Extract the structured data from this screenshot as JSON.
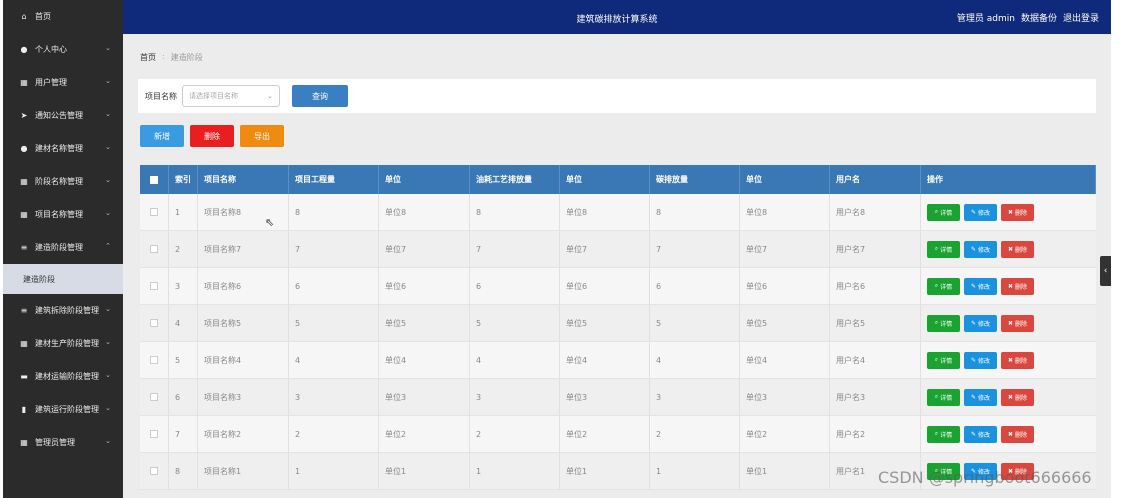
{
  "sidebar": {
    "items": [
      {
        "label": "首页",
        "icon": "home-icon",
        "glyph": "⌂",
        "chev": ""
      },
      {
        "label": "个人中心",
        "icon": "user-icon",
        "glyph": "●",
        "chev": "⌄"
      },
      {
        "label": "用户管理",
        "icon": "grid-icon",
        "glyph": "▦",
        "chev": "⌄"
      },
      {
        "label": "通知公告管理",
        "icon": "send-icon",
        "glyph": "➤",
        "chev": "⌄"
      },
      {
        "label": "建材名称管理",
        "icon": "pin-icon",
        "glyph": "●",
        "chev": "⌄"
      },
      {
        "label": "阶段名称管理",
        "icon": "grid-icon",
        "glyph": "▦",
        "chev": "⌄"
      },
      {
        "label": "项目名称管理",
        "icon": "grid-icon",
        "glyph": "▦",
        "chev": "⌄"
      },
      {
        "label": "建造阶段管理",
        "icon": "list-icon",
        "glyph": "≡",
        "chev": "⌃"
      }
    ],
    "sub_item": "建造阶段",
    "items_after": [
      {
        "label": "建筑拆除阶段管理",
        "icon": "list-icon",
        "glyph": "≡",
        "chev": "⌄"
      },
      {
        "label": "建材生产阶段管理",
        "icon": "grid-icon",
        "glyph": "▦",
        "chev": "⌄"
      },
      {
        "label": "建材运输阶段管理",
        "icon": "monitor-icon",
        "glyph": "▬",
        "chev": "⌄"
      },
      {
        "label": "建筑运行阶段管理",
        "icon": "chart-icon",
        "glyph": "▮",
        "chev": "⌄"
      },
      {
        "label": "管理员管理",
        "icon": "grid-icon",
        "glyph": "▦",
        "chev": "⌄"
      }
    ]
  },
  "topbar": {
    "title": "建筑碳排放计算系统",
    "role": "管理员 admin",
    "backup": "数据备份",
    "logout": "退出登录"
  },
  "breadcrumb": {
    "home": "首页",
    "sep": ":",
    "current": "建造阶段"
  },
  "search": {
    "label": "项目名称",
    "placeholder": "请选择项目名称",
    "button": "查询"
  },
  "actions": {
    "add": "新增",
    "delete": "删除",
    "export": "导出"
  },
  "colors": {
    "add": "#3a9be3",
    "delete": "#e91e1e",
    "export": "#f08b12",
    "header": "#3a77b5",
    "topbar": "#0f2a7a"
  },
  "table": {
    "headers": [
      "索引",
      "项目名称",
      "项目工程量",
      "单位",
      "油耗工艺排放量",
      "单位",
      "碳排放量",
      "单位",
      "用户名",
      "操作"
    ],
    "ops": {
      "detail": "详情",
      "edit": "修改",
      "delete": "删除"
    },
    "rows": [
      [
        "1",
        "项目名称8",
        "8",
        "单位8",
        "8",
        "单位8",
        "8",
        "单位8",
        "用户名8"
      ],
      [
        "2",
        "项目名称7",
        "7",
        "单位7",
        "7",
        "单位7",
        "7",
        "单位7",
        "用户名7"
      ],
      [
        "3",
        "项目名称6",
        "6",
        "单位6",
        "6",
        "单位6",
        "6",
        "单位6",
        "用户名6"
      ],
      [
        "4",
        "项目名称5",
        "5",
        "单位5",
        "5",
        "单位5",
        "5",
        "单位5",
        "用户名5"
      ],
      [
        "5",
        "项目名称4",
        "4",
        "单位4",
        "4",
        "单位4",
        "4",
        "单位4",
        "用户名4"
      ],
      [
        "6",
        "项目名称3",
        "3",
        "单位3",
        "3",
        "单位3",
        "3",
        "单位3",
        "用户名3"
      ],
      [
        "7",
        "项目名称2",
        "2",
        "单位2",
        "2",
        "单位2",
        "2",
        "单位2",
        "用户名2"
      ],
      [
        "8",
        "项目名称1",
        "1",
        "单位1",
        "1",
        "单位1",
        "1",
        "单位1",
        "用户名1"
      ]
    ]
  },
  "watermark": "CSDN @springboot666666"
}
